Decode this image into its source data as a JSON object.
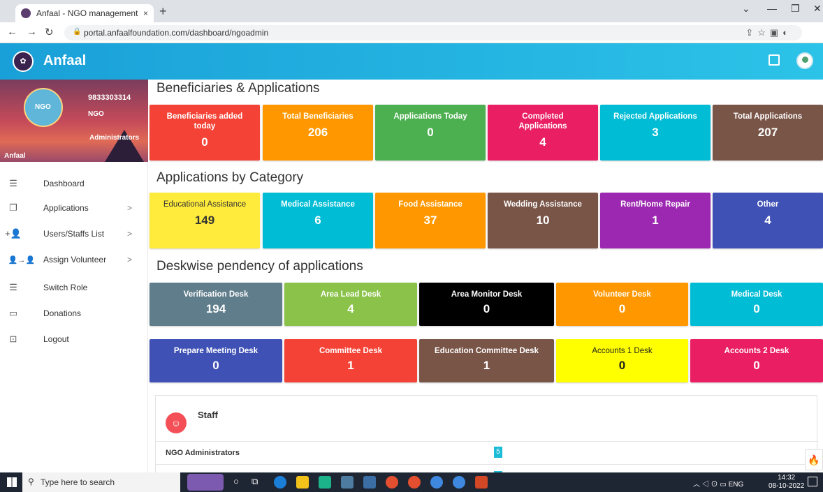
{
  "browser": {
    "tab_title": "Anfaal - NGO management",
    "tab_close": "×",
    "new_tab": "+",
    "url": "portal.anfaalfoundation.com/dashboard/ngoadmin"
  },
  "app": {
    "name": "Anfaal"
  },
  "sidebar": {
    "phone": "9833303314",
    "org": "NGO",
    "role": "Administrators",
    "username": "Anfaal",
    "menu": [
      {
        "label": "Dashboard",
        "icon": "list-icon",
        "arrow": ""
      },
      {
        "label": "Applications",
        "icon": "copy-icon",
        "arrow": ">"
      },
      {
        "label": "Users/Staffs List",
        "icon": "user-add-icon",
        "arrow": ">"
      },
      {
        "label": "Assign Volunteer",
        "icon": "assign-icon",
        "arrow": ">"
      },
      {
        "label": "Switch Role",
        "icon": "list-icon",
        "arrow": ""
      },
      {
        "label": "Donations",
        "icon": "card-icon",
        "arrow": ""
      },
      {
        "label": "Logout",
        "icon": "lock-icon",
        "arrow": ""
      }
    ]
  },
  "sections": {
    "beneficiaries_title": "Beneficiaries & Applications",
    "category_title": "Applications by Category",
    "desk_title": "Deskwise pendency of applications"
  },
  "beneficiary_cards": [
    {
      "label": "Beneficiaries added today",
      "value": "0",
      "color": "#f44336"
    },
    {
      "label": "Total Beneficiaries",
      "value": "206",
      "color": "#ff9800"
    },
    {
      "label": "Applications Today",
      "value": "0",
      "color": "#4caf50"
    },
    {
      "label": "Completed Applications",
      "value": "4",
      "color": "#e91e63"
    },
    {
      "label": "Rejected Applications",
      "value": "3",
      "color": "#00bcd4"
    },
    {
      "label": "Total Applications",
      "value": "207",
      "color": "#795548"
    }
  ],
  "category_cards": [
    {
      "label": "Educational Assistance",
      "value": "149",
      "color": "#ffeb3b"
    },
    {
      "label": "Medical Assistance",
      "value": "6",
      "color": "#00bcd4"
    },
    {
      "label": "Food Assistance",
      "value": "37",
      "color": "#ff9800"
    },
    {
      "label": "Wedding Assistance",
      "value": "10",
      "color": "#795548"
    },
    {
      "label": "Rent/Home Repair",
      "value": "1",
      "color": "#9c27b0"
    },
    {
      "label": "Other",
      "value": "4",
      "color": "#3f51b5"
    }
  ],
  "desk_cards_row1": [
    {
      "label": "Verification Desk",
      "value": "194",
      "color": "#607d8b"
    },
    {
      "label": "Area Lead Desk",
      "value": "4",
      "color": "#8bc34a"
    },
    {
      "label": "Area Monitor Desk",
      "value": "0",
      "color": "#000000"
    },
    {
      "label": "Volunteer Desk",
      "value": "0",
      "color": "#ff9800"
    },
    {
      "label": "Medical Desk",
      "value": "0",
      "color": "#00bcd4"
    }
  ],
  "desk_cards_row2": [
    {
      "label": "Prepare Meeting Desk",
      "value": "0",
      "color": "#3f51b5"
    },
    {
      "label": "Committee Desk",
      "value": "1",
      "color": "#f44336"
    },
    {
      "label": "Education Committee Desk",
      "value": "1",
      "color": "#795548"
    },
    {
      "label": "Accounts 1 Desk",
      "value": "0",
      "color": "#ffff00"
    },
    {
      "label": "Accounts 2 Desk",
      "value": "0",
      "color": "#e91e63"
    }
  ],
  "staff": {
    "title": "Staff",
    "row_label": "NGO Administrators",
    "row_value": "5"
  },
  "taskbar": {
    "search_placeholder": "Type here to search",
    "lang": "ENG",
    "time": "14:32",
    "date": "08-10-2022"
  }
}
